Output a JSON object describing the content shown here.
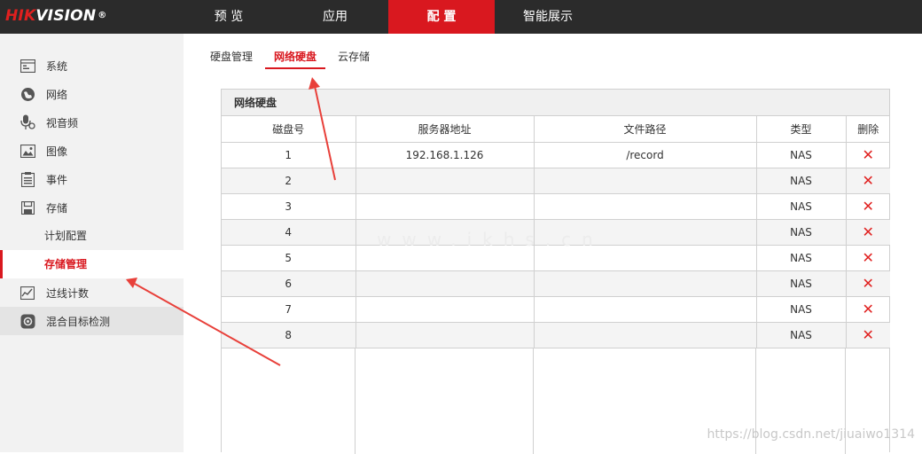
{
  "brand": {
    "logo_hik": "HIK",
    "logo_vision": "VISION",
    "logo_reg": "®"
  },
  "topnav": [
    {
      "label": "预 览",
      "active": false
    },
    {
      "label": "应用",
      "active": false
    },
    {
      "label": "配 置",
      "active": true
    },
    {
      "label": "智能展示",
      "active": false
    }
  ],
  "sidebar": {
    "items": [
      {
        "label": "系统",
        "icon": "monitor-icon"
      },
      {
        "label": "网络",
        "icon": "globe-icon"
      },
      {
        "label": "视音频",
        "icon": "mic-icon"
      },
      {
        "label": "图像",
        "icon": "image-icon"
      },
      {
        "label": "事件",
        "icon": "list-icon"
      },
      {
        "label": "存储",
        "icon": "save-icon"
      }
    ],
    "sub_items": [
      {
        "label": "计划配置",
        "active": false
      },
      {
        "label": "存储管理",
        "active": true
      }
    ],
    "items_after": [
      {
        "label": "过线计数",
        "icon": "chart-icon"
      },
      {
        "label": "混合目标检测",
        "icon": "target-icon"
      }
    ]
  },
  "tabs": [
    {
      "label": "硬盘管理",
      "active": false
    },
    {
      "label": "网络硬盘",
      "active": true
    },
    {
      "label": "云存储",
      "active": false
    }
  ],
  "panel": {
    "title": "网络硬盘",
    "columns": [
      "磁盘号",
      "服务器地址",
      "文件路径",
      "类型",
      "删除"
    ],
    "rows": [
      {
        "disk": "1",
        "server": "192.168.1.126",
        "path": "/record",
        "type": "NAS",
        "del": "✕"
      },
      {
        "disk": "2",
        "server": "",
        "path": "",
        "type": "NAS",
        "del": "✕"
      },
      {
        "disk": "3",
        "server": "",
        "path": "",
        "type": "NAS",
        "del": "✕"
      },
      {
        "disk": "4",
        "server": "",
        "path": "",
        "type": "NAS",
        "del": "✕"
      },
      {
        "disk": "5",
        "server": "",
        "path": "",
        "type": "NAS",
        "del": "✕"
      },
      {
        "disk": "6",
        "server": "",
        "path": "",
        "type": "NAS",
        "del": "✕"
      },
      {
        "disk": "7",
        "server": "",
        "path": "",
        "type": "NAS",
        "del": "✕"
      },
      {
        "disk": "8",
        "server": "",
        "path": "",
        "type": "NAS",
        "del": "✕"
      }
    ]
  },
  "watermark": "https://blog.csdn.net/jiuaiwo1314",
  "faint_watermark": "www.ikhs.cn",
  "colors": {
    "accent": "#d9181f",
    "topbar": "#2b2b2b",
    "sidebar": "#f2f2f2",
    "arrow": "#e8403a"
  }
}
